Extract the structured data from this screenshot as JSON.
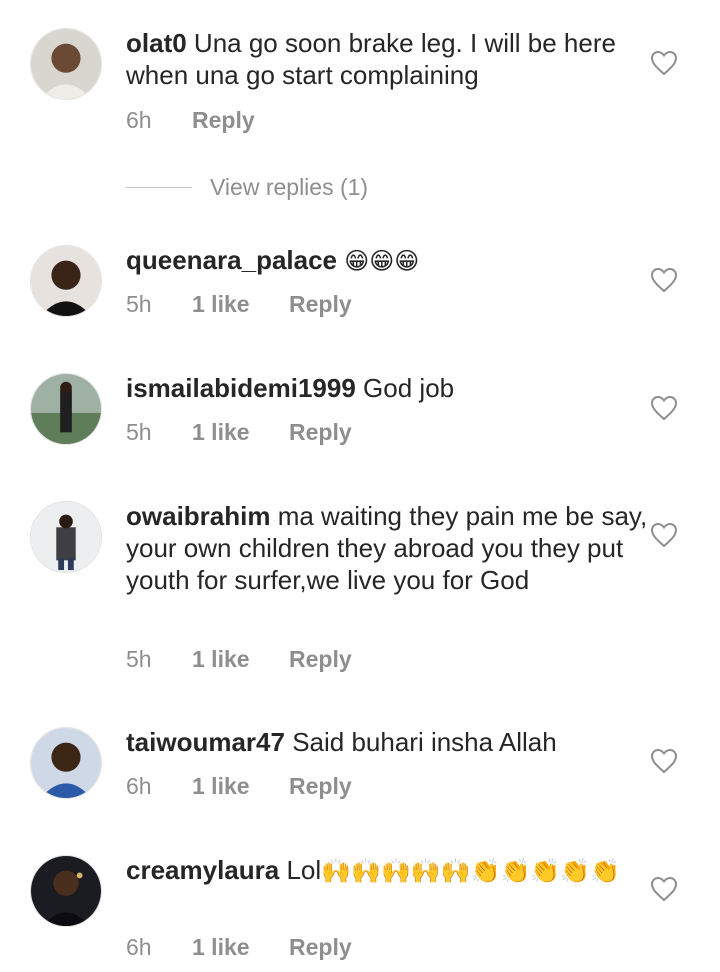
{
  "comments": [
    {
      "username": "olat0",
      "text": "Una go soon brake leg. I will be here when una go start complaining",
      "emoji": "",
      "time": "6h",
      "likes": "",
      "reply": "Reply"
    },
    {
      "username": "queenara_palace",
      "text": "",
      "emoji": "😁😁😁",
      "time": "5h",
      "likes": "1 like",
      "reply": "Reply"
    },
    {
      "username": "ismailabidemi1999",
      "text": "God job",
      "emoji": "",
      "time": "5h",
      "likes": "1 like",
      "reply": "Reply"
    },
    {
      "username": "owaibrahim",
      "text": "ma waiting they pain me be say, your own children they abroad you they put youth for surfer,we live you for God",
      "emoji": "",
      "time": "5h",
      "likes": "1 like",
      "reply": "Reply"
    },
    {
      "username": "taiwoumar47",
      "text": "Said buhari insha Allah",
      "emoji": "",
      "time": "6h",
      "likes": "1 like",
      "reply": "Reply"
    },
    {
      "username": "creamylaura",
      "text": "Lol",
      "emoji": "🙌🙌🙌🙌🙌👏👏👏👏👏",
      "time": "6h",
      "likes": "1 like",
      "reply": "Reply"
    }
  ],
  "view_replies": "View replies (1)",
  "icons": {
    "like": "heart-outline-icon"
  },
  "colors": {
    "text": "#262626",
    "secondary": "#8e8e8e",
    "background": "#ffffff"
  }
}
